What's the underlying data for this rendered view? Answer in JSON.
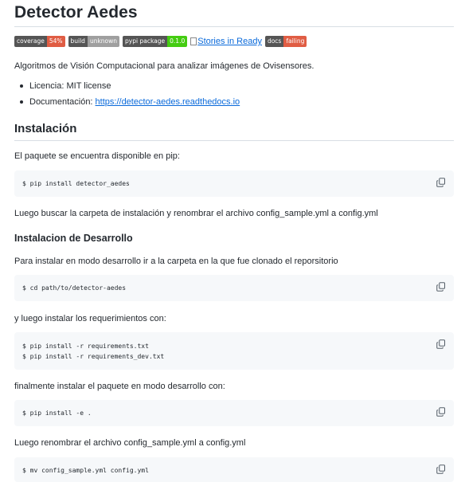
{
  "title": "Detector Aedes",
  "badges": [
    {
      "label": "coverage",
      "value": "54%",
      "color": "#e05d44"
    },
    {
      "label": "build",
      "value": "unknown",
      "color": "#9f9f9f"
    },
    {
      "label": "pypi package",
      "value": "0.1.0",
      "color": "#4c1"
    },
    {
      "link_text": "Stories in Ready"
    },
    {
      "label": "docs",
      "value": "failing",
      "color": "#e05d44"
    }
  ],
  "intro": "Algoritmos de Visión Computacional para analizar imágenes de Ovisensores.",
  "list": {
    "license": "Licencia: MIT license",
    "docs_label": "Documentación: ",
    "docs_link": "https://detector-aedes.readthedocs.io"
  },
  "install": {
    "heading": "Instalación",
    "pip_text": "El paquete se encuentra disponible en pip:",
    "pip_cmd": "$ pip install detector_aedes",
    "after_text": "Luego buscar la carpeta de instalación y renombrar el archivo config_sample.yml a config.yml"
  },
  "dev": {
    "heading": "Instalacion de Desarrollo",
    "clone_text": "Para instalar en modo desarrollo ir a la carpeta en la que fue clonado el reporsitorio",
    "cd_cmd": "$ cd path/to/detector-aedes",
    "req_text": "y luego instalar los requerimientos con:",
    "req_cmd": "$ pip install -r requirements.txt\n$ pip install -r requirements_dev.txt",
    "final_text": "finalmente instalar el paquete en modo desarrollo con:",
    "final_cmd": "$ pip install -e .",
    "rename_text": "Luego renombrar el archivo config_sample.yml a config.yml",
    "mv_cmd": "$ mv config_sample.yml config.yml"
  },
  "icons": {
    "copy": "copy-icon"
  }
}
